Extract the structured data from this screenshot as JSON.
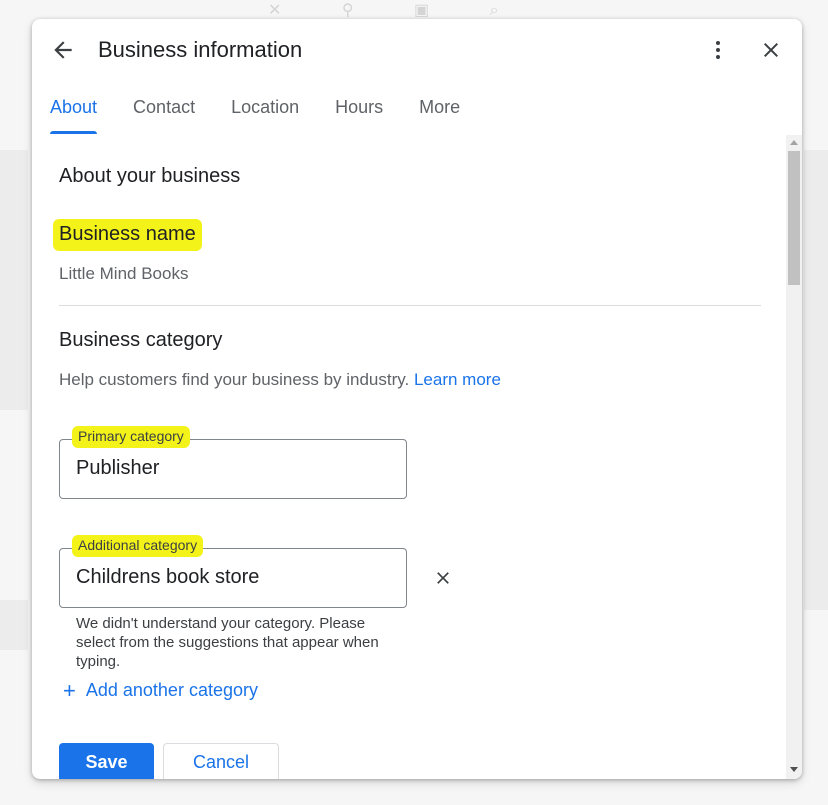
{
  "dialog": {
    "title": "Business information",
    "back_icon": "arrow-back-icon",
    "more_icon": "more-vert-icon",
    "close_icon": "close-icon"
  },
  "tabs": [
    {
      "label": "About",
      "active": true
    },
    {
      "label": "Contact",
      "active": false
    },
    {
      "label": "Location",
      "active": false
    },
    {
      "label": "Hours",
      "active": false
    },
    {
      "label": "More",
      "active": false
    }
  ],
  "about": {
    "section_title": "About your business",
    "business_name_label": "Business name",
    "business_name_value": "Little Mind Books"
  },
  "category": {
    "title": "Business category",
    "help_text": "Help customers find your business by industry.",
    "learn_more": "Learn more",
    "primary_label": "Primary category",
    "primary_value": "Publisher",
    "additional_label": "Additional category",
    "additional_value": "Childrens book store",
    "error_text": "We didn't understand your category. Please select from the suggestions that appear when typing.",
    "add_another": "Add another category",
    "add_icon": "plus-icon"
  },
  "actions": {
    "save_label": "Save",
    "cancel_label": "Cancel"
  },
  "colors": {
    "accent": "#1a73e8",
    "highlight": "#f3f31a",
    "text_primary": "#202124",
    "text_secondary": "#5f6368"
  }
}
